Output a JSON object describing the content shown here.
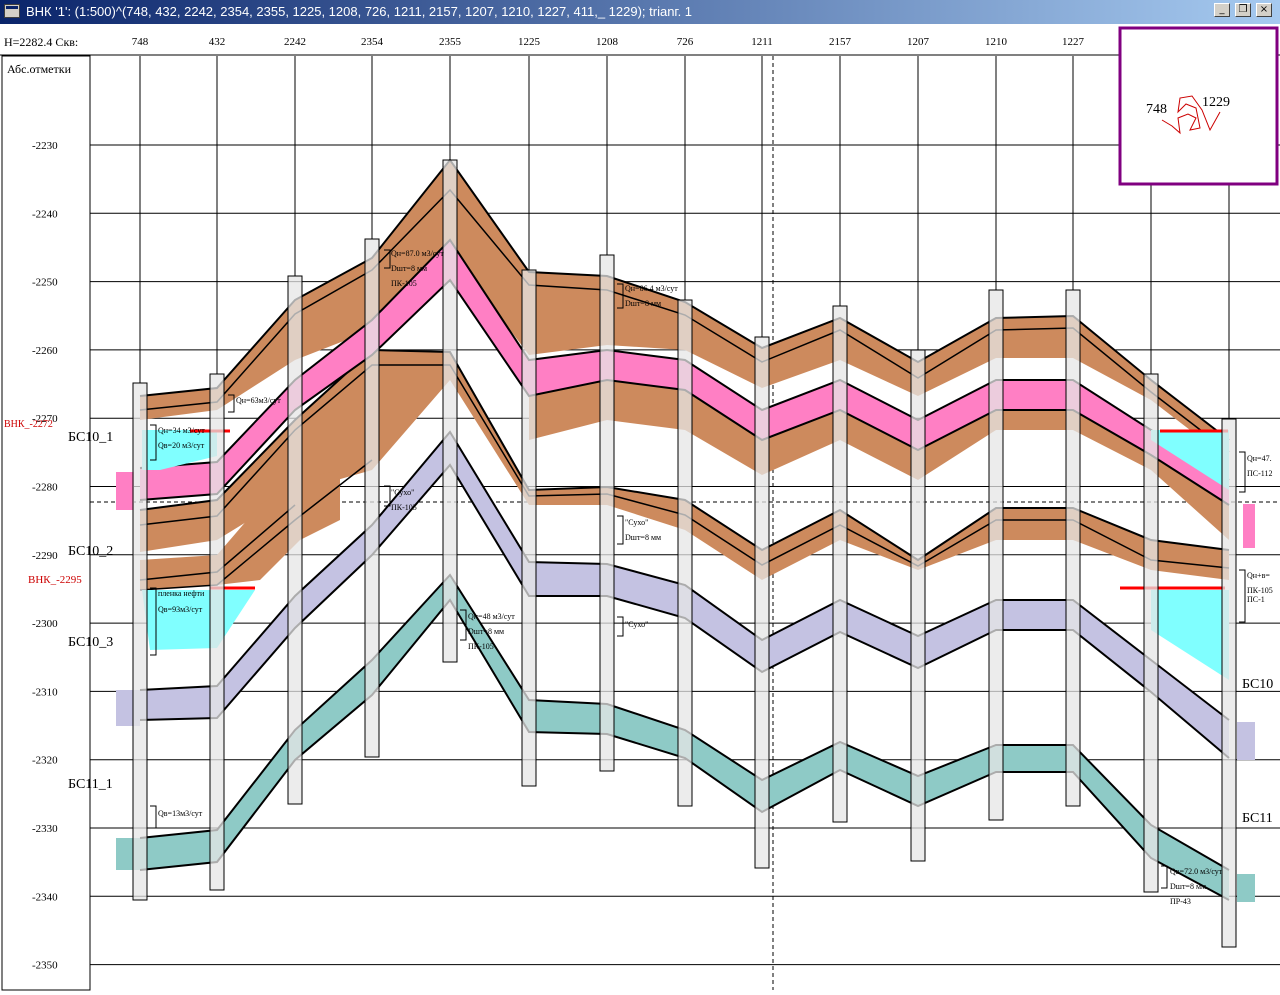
{
  "window": {
    "title": "ВНК '1': (1:500)^(748, 432, 2242, 2354, 2355, 1225, 1208, 726, 1211, 2157, 1207, 1210, 1227, 411,_ 1229); trianг. 1",
    "buttons": {
      "minimize": "_",
      "restore": "❐",
      "close": "×"
    }
  },
  "header": {
    "h_label": "H=2282.4 Скв:",
    "axis_title": "Абс.отметки"
  },
  "wells": [
    "748",
    "432",
    "2242",
    "2354",
    "2355",
    "1225",
    "1208",
    "726",
    "1211",
    "2157",
    "1207",
    "1210",
    "1227"
  ],
  "depth_ticks": [
    "-2230",
    "-2240",
    "-2250",
    "-2260",
    "-2270",
    "-2280",
    "-2290",
    "-2300",
    "-2310",
    "-2320",
    "-2330",
    "-2340",
    "-2350"
  ],
  "depth_values": [
    -2230,
    -2240,
    -2250,
    -2260,
    -2270,
    -2280,
    -2290,
    -2300,
    -2310,
    -2320,
    -2330,
    -2340,
    -2350
  ],
  "vnk_labels": {
    "upper": "ВНК_-2272",
    "lower": "ВНК_-2295"
  },
  "layer_labels": {
    "bs10_1": "БС10_1",
    "bs10_2": "БС10_2",
    "bs10_3": "БС10_3",
    "bs11_1": "БС11_1",
    "right_bs10": "БС10",
    "right_bs11": "БС11"
  },
  "annotations": {
    "qn34": "Qн=34 м3/сут",
    "qv20": "Qв=20 м3/сут",
    "qn63": "Qн=63м3/сут",
    "plenka": "пленка нефти",
    "qv93": "Qв=93м3/сут",
    "qv13": "Qв=13м3/сут",
    "qn87": "Qн=87.0 м3/сут",
    "dsht8a": "Dшт=8 мм",
    "pk105a": "ПК-105",
    "sukho1": "\"Сухо\"",
    "pk105b": "ПК-105",
    "qn48": "Qн=48 м3/сут",
    "dsht8b": "Dшт=8 мм",
    "pk105c": "ПК-105",
    "qn86": "Qн=86.4 м3/сут",
    "dsht8c": "Dшт=8 мм",
    "sukho2": "\"Сухо\"",
    "dsht8d": "Dшт=8 мм",
    "sukho3": "\"Сухо\"",
    "qv72": "Qв=72.0 м3/сут",
    "dsht8e": "Dшт=8 мм",
    "pr43": "ПР-43",
    "qn47": "Qн=47.",
    "ps112": "ПС-112",
    "qnv": "Qн+в=",
    "pk105d": "ПК-105",
    "pk105e": "ПС-1"
  },
  "minimap": {
    "left_label": "748",
    "right_label": "1229"
  },
  "colors": {
    "reservoir": "#cd8a5d",
    "oil_pink": "#ff7fc4",
    "water_cyan": "#80ffff",
    "lavender": "#c4c2e2",
    "teal": "#8ecac6",
    "vnk_red": "#ff0000",
    "minimap_border": "#800080"
  }
}
